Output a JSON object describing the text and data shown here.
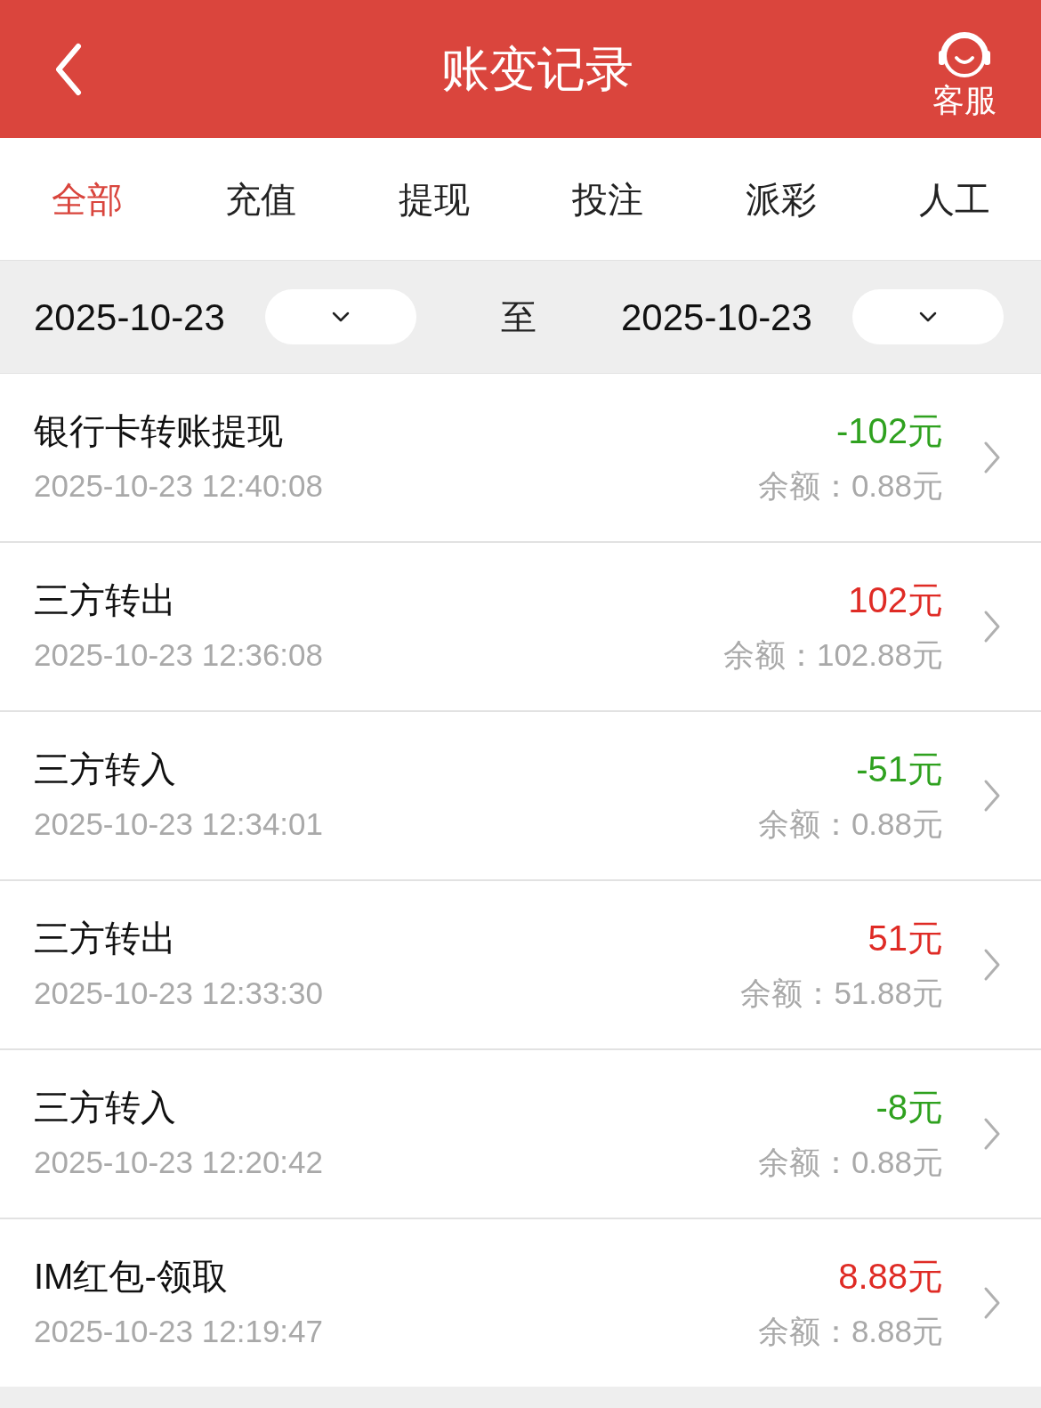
{
  "header": {
    "title": "账变记录",
    "service": "客服"
  },
  "tabs": [
    {
      "label": "全部",
      "selected": true
    },
    {
      "label": "充值",
      "selected": false
    },
    {
      "label": "提现",
      "selected": false
    },
    {
      "label": "投注",
      "selected": false
    },
    {
      "label": "派彩",
      "selected": false
    },
    {
      "label": "人工",
      "selected": false
    }
  ],
  "date_range": {
    "start": "2025-10-23",
    "separator": "至",
    "end": "2025-10-23"
  },
  "records": [
    {
      "title": "银行卡转账提现",
      "time": "2025-10-23 12:40:08",
      "amount": "-102元",
      "kind": "out",
      "balance": "余额：0.88元"
    },
    {
      "title": "三方转出",
      "time": "2025-10-23 12:36:08",
      "amount": "102元",
      "kind": "in",
      "balance": "余额：102.88元"
    },
    {
      "title": "三方转入",
      "time": "2025-10-23 12:34:01",
      "amount": "-51元",
      "kind": "out",
      "balance": "余额：0.88元"
    },
    {
      "title": "三方转出",
      "time": "2025-10-23 12:33:30",
      "amount": "51元",
      "kind": "in",
      "balance": "余额：51.88元"
    },
    {
      "title": "三方转入",
      "time": "2025-10-23 12:20:42",
      "amount": "-8元",
      "kind": "out",
      "balance": "余额：0.88元"
    },
    {
      "title": "IM红包-领取",
      "time": "2025-10-23 12:19:47",
      "amount": "8.88元",
      "kind": "in",
      "balance": "余额：8.88元"
    }
  ]
}
